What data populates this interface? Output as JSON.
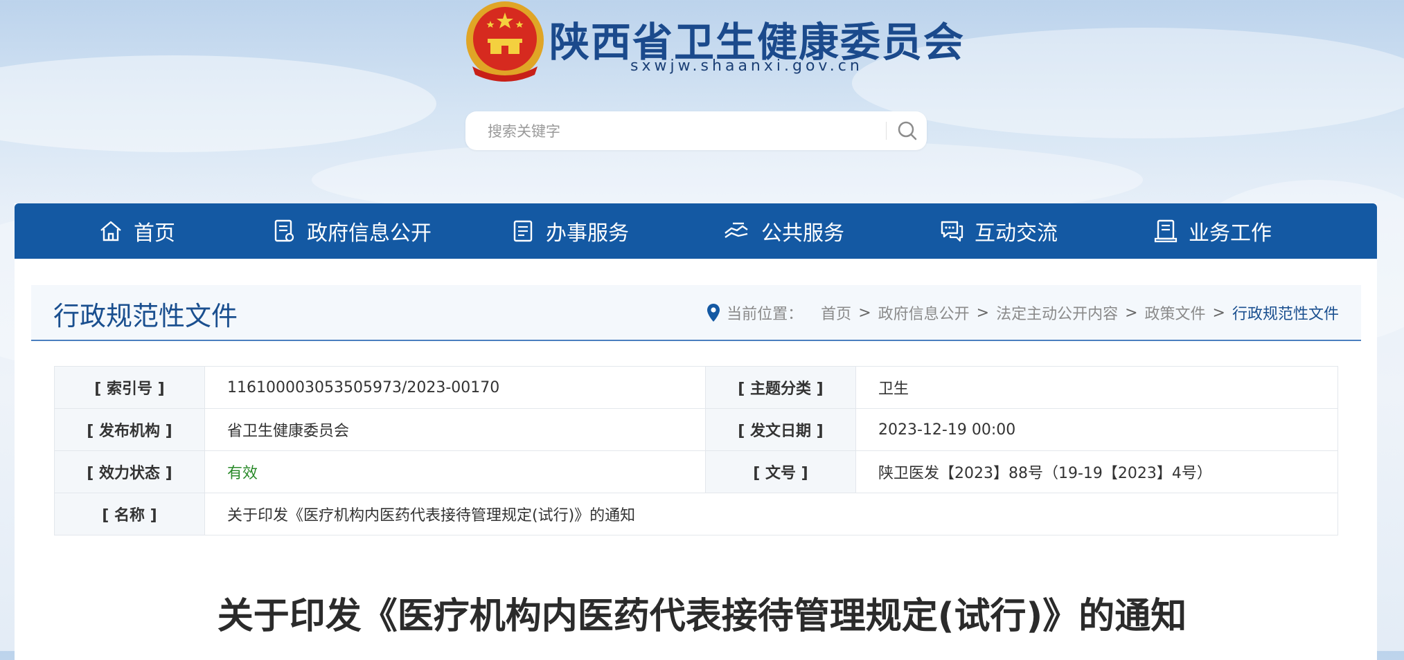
{
  "header": {
    "site_title": "陕西省卫生健康委员会",
    "site_domain": "sxwjw.shaanxi.gov.cn",
    "emblem_icon": "national-emblem-icon",
    "search": {
      "placeholder": "搜索关键字",
      "value": "",
      "button_icon": "search-icon"
    }
  },
  "nav": {
    "items": [
      {
        "label": "首页",
        "icon": "home-icon"
      },
      {
        "label": "政府信息公开",
        "icon": "document-icon"
      },
      {
        "label": "办事服务",
        "icon": "list-icon"
      },
      {
        "label": "公共服务",
        "icon": "handshake-icon"
      },
      {
        "label": "互动交流",
        "icon": "chat-icon"
      },
      {
        "label": "业务工作",
        "icon": "briefcase-icon"
      }
    ]
  },
  "section": {
    "title": "行政规范性文件",
    "breadcrumb_label": "当前位置：",
    "breadcrumb": [
      "首页",
      "政府信息公开",
      "法定主动公开内容",
      "政策文件",
      "行政规范性文件"
    ],
    "separator": ">"
  },
  "info": {
    "index_no_label": "[ 索引号 ]",
    "index_no": "116100003053505973/2023-00170",
    "topic_label": "[ 主题分类 ]",
    "topic": "卫生",
    "publisher_label": "[ 发布机构 ]",
    "publisher": "省卫生健康委员会",
    "date_label": "[ 发文日期 ]",
    "date": "2023-12-19 00:00",
    "status_label": "[ 效力状态 ]",
    "status": "有效",
    "doc_no_label": "[ 文号 ]",
    "doc_no": "陕卫医发【2023】88号（19-19【2023】4号）",
    "name_label": "[ 名称 ]",
    "name": "关于印发《医疗机构内医药代表接待管理规定(试行)》的通知"
  },
  "document": {
    "title": "关于印发《医疗机构内医药代表接待管理规定(试行)》的通知"
  },
  "colors": {
    "nav_bg": "#1459a3",
    "title_blue": "#1a4f8f",
    "valid_green": "#2a8a2a"
  }
}
